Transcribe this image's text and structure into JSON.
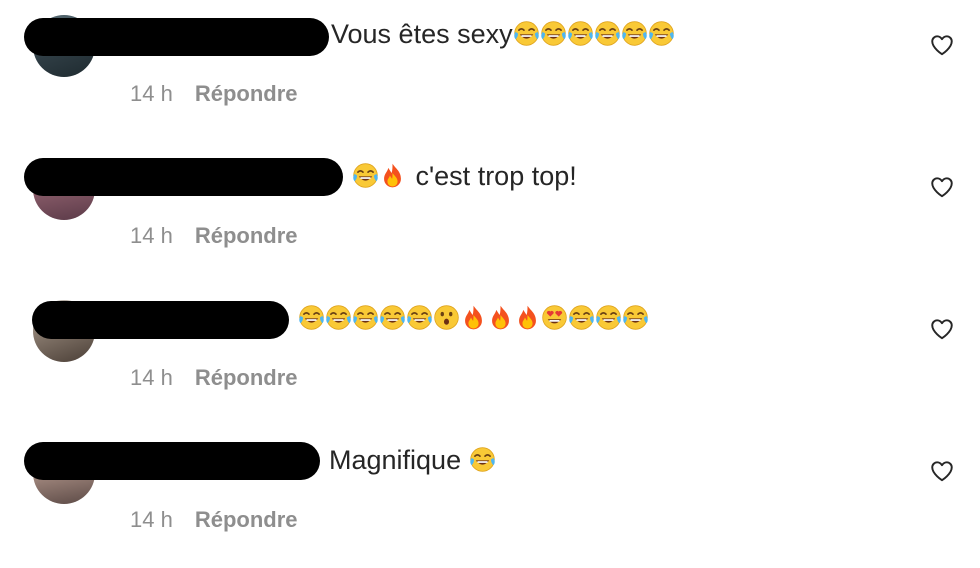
{
  "comments": [
    {
      "text": "Vous êtes sexy",
      "emojis_after": [
        "face-with-tears-of-joy",
        "face-with-tears-of-joy",
        "face-with-tears-of-joy",
        "face-with-tears-of-joy",
        "face-with-tears-of-joy",
        "face-with-tears-of-joy"
      ],
      "time": "14 h",
      "reply_label": "Répondre",
      "avatar_color": "#3b4a52"
    },
    {
      "emojis_before": [
        "face-with-tears-of-joy",
        "fire"
      ],
      "text": "c'est trop top!",
      "time": "14 h",
      "reply_label": "Répondre",
      "avatar_color": "#6b4a55"
    },
    {
      "emojis_after": [
        "face-with-tears-of-joy",
        "face-with-tears-of-joy",
        "face-with-tears-of-joy",
        "face-with-tears-of-joy",
        "face-with-tears-of-joy",
        "hushed-face",
        "fire",
        "fire",
        "fire",
        "smiling-face-with-heart-eyes",
        "face-with-tears-of-joy",
        "face-with-tears-of-joy",
        "face-with-tears-of-joy"
      ],
      "time": "14 h",
      "reply_label": "Répondre",
      "avatar_color": "#5a504a"
    },
    {
      "text": "Magnifique",
      "emojis_after": [
        "face-with-tears-of-joy"
      ],
      "time": "14 h",
      "reply_label": "Répondre",
      "avatar_color": "#7a6a66"
    }
  ],
  "icons": {
    "like": "heart-outline-icon"
  },
  "colors": {
    "text": "#262626",
    "meta": "#8e8e8e",
    "redaction": "#000000"
  }
}
